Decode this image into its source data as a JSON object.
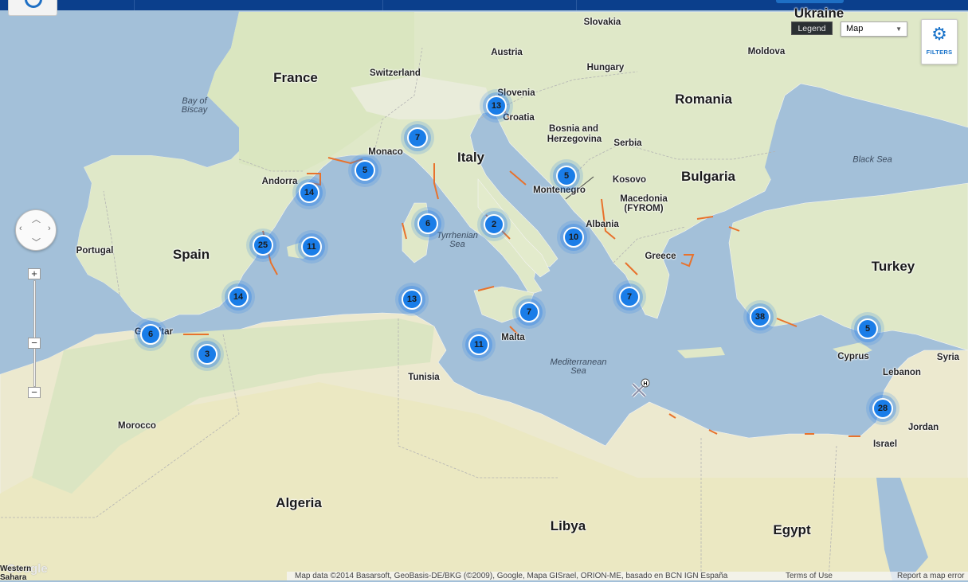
{
  "topbar": {},
  "controls": {
    "zoom_in": "+",
    "zoom_out": "−",
    "zoom_mid": "−",
    "legend_label": "Legend",
    "map_type": "Map",
    "filters_label": "FILTERS"
  },
  "labels": {
    "ukraine": "Ukraine",
    "slovakia": "Slovakia",
    "moldova": "Moldova",
    "austria": "Austria",
    "hungary": "Hungary",
    "france": "France",
    "switzerland": "Switzerland",
    "slovenia": "Slovenia",
    "croatia": "Croatia",
    "romania": "Romania",
    "bay_biscay": "Bay of\nBiscay",
    "bosnia": "Bosnia and",
    "herzegovina": "Herzegovina",
    "serbia": "Serbia",
    "monaco": "Monaco",
    "italy": "Italy",
    "black_sea": "Black Sea",
    "kosovo": "Kosovo",
    "bulgaria": "Bulgaria",
    "andorra": "Andorra",
    "montenegro": "Montenegro",
    "macedonia": "Macedonia",
    "fyrom": "(FYROM)",
    "albania": "Albania",
    "tyrrhenian": "Tyrrhenian\nSea",
    "portugal": "Portugal",
    "spain": "Spain",
    "greece": "Greece",
    "turkey": "Turkey",
    "gibraltar": "Gibraltar",
    "malta": "Malta",
    "med_sea": "Mediterranean\nSea",
    "cyprus": "Cyprus",
    "syria": "Syria",
    "tunisia": "Tunisia",
    "lebanon": "Lebanon",
    "morocco": "Morocco",
    "jordan": "Jordan",
    "israel": "Israel",
    "algeria": "Algeria",
    "libya": "Libya",
    "egypt": "Egypt",
    "western_sahara": "Western\nSahara"
  },
  "clusters": [
    {
      "count": "13"
    },
    {
      "count": "7"
    },
    {
      "count": "5"
    },
    {
      "count": "5"
    },
    {
      "count": "14"
    },
    {
      "count": "6"
    },
    {
      "count": "2"
    },
    {
      "count": "10"
    },
    {
      "count": "25"
    },
    {
      "count": "11"
    },
    {
      "count": "14"
    },
    {
      "count": "13"
    },
    {
      "count": "7"
    },
    {
      "count": "7"
    },
    {
      "count": "38"
    },
    {
      "count": "5"
    },
    {
      "count": "6"
    },
    {
      "count": "3"
    },
    {
      "count": "11"
    },
    {
      "count": "28"
    }
  ],
  "footer": {
    "attribution": "Map data ©2014 Basarsoft, GeoBasis-DE/BKG (©2009), Google, Mapa GISrael, ORION-ME, basado en BCN IGN España",
    "terms": "Terms of Use",
    "report": "Report a map error"
  },
  "google_logo": "Google",
  "colors": {
    "sea": "#a3c0d9",
    "land": "#ecead6",
    "cluster": "#1a7de8",
    "protected_area": "#e8722c",
    "topbar": "#0b3f8c"
  }
}
